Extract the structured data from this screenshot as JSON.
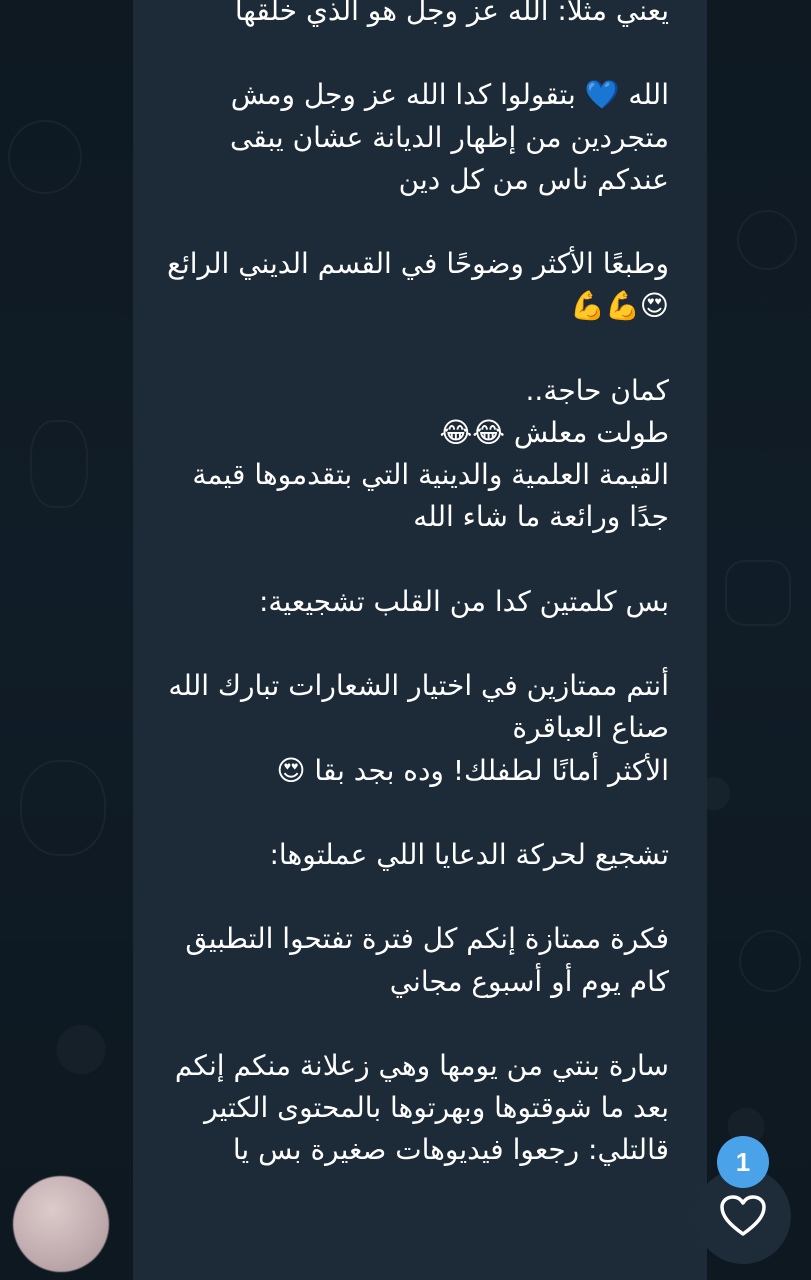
{
  "message": {
    "text": "يعني مثلًا: الله عز وجل هو الذي خلقها\n\nالله 💙 بتقولوا كدا الله عز وجل ومش متجردين من إظهار الديانة عشان يبقى عندكم ناس من كل دين\n\nوطبعًا الأكثر وضوحًا في القسم الديني الرائع 😍💪💪\n\nكمان حاجة..\nطولت معلش 😂😂\nالقيمة العلمية والدينية التي بتقدموها قيمة جدًا ورائعة ما شاء الله\n\nبس كلمتين كدا من القلب تشجيعية:\n\nأنتم ممتازين في اختيار الشعارات تبارك الله\nصناع العباقرة\nالأكثر أمانًا لطفلك! وده بجد بقا 😍\n\nتشجيع لحركة الدعايا اللي عملتوها:\n\nفكرة ممتازة إنكم كل فترة تفتحوا التطبيق كام يوم أو أسبوع مجاني\n\nسارة بنتي من يومها وهي زعلانة منكم إنكم بعد ما شوقتوها وبهرتوها بالمحتوى الكتير\nقالتلي: رجعوا فيديوهات صغيرة بس يا"
  },
  "reaction": {
    "count": "1",
    "icon": "heart-icon"
  },
  "avatar": {
    "icon": "avatar-blurred"
  },
  "colors": {
    "background": "#0f1a24",
    "bubble": "#1d2b39",
    "text": "#ffffff",
    "badge": "#4aa3e8",
    "like_button": "#1e2c3a"
  }
}
